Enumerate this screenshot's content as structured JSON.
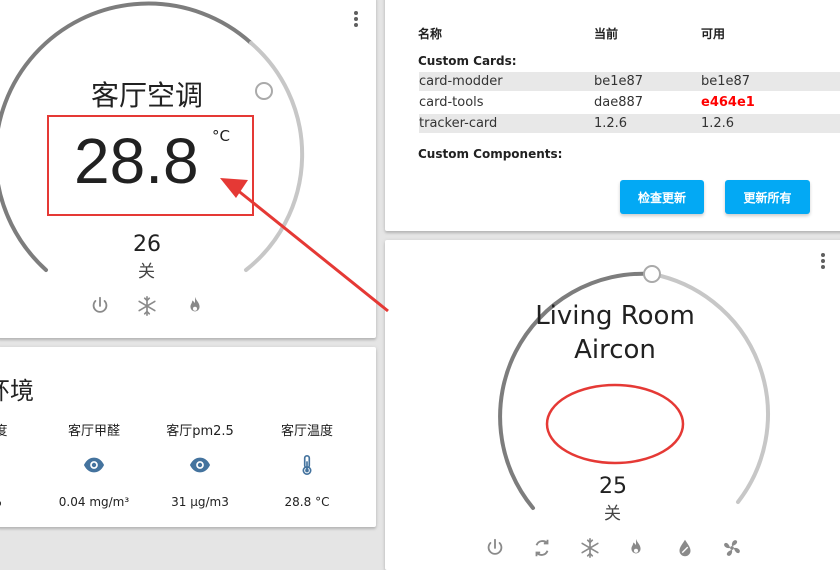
{
  "thermostat_cn": {
    "name": "客厅空调",
    "current_temp": "28.8",
    "unit": "°C",
    "target": "26",
    "mode": "关",
    "controls": [
      "power-icon",
      "snowflake-icon",
      "fire-icon"
    ]
  },
  "updates": {
    "columns": [
      "名称",
      "当前",
      "可用"
    ],
    "custom_cards_label": "Custom Cards:",
    "rows": [
      {
        "name": "card-modder",
        "current": "be1e87",
        "available": "be1e87",
        "outdated": false
      },
      {
        "name": "card-tools",
        "current": "dae887",
        "available": "e464e1",
        "outdated": true
      },
      {
        "name": "tracker-card",
        "current": "1.2.6",
        "available": "1.2.6",
        "outdated": false
      }
    ],
    "custom_components_label": "Custom Components:",
    "check_button": "检查更新",
    "update_all_button": "更新所有",
    "outdated_color": "#ff0000",
    "button_color": "#03a9f4"
  },
  "environment": {
    "title_fragment": "环境",
    "sensors": [
      {
        "name": "度",
        "value": "%",
        "icon": ""
      },
      {
        "name": "客厅甲醛",
        "value": "0.04 mg/m³",
        "icon": "eye-icon"
      },
      {
        "name": "客厅pm2.5",
        "value": "31 μg/m3",
        "icon": "eye-icon"
      },
      {
        "name": "客厅温度",
        "value": "28.8 °C",
        "icon": "thermometer-icon"
      }
    ]
  },
  "thermostat_en": {
    "name_line1": "Living Room",
    "name_line2": "Aircon",
    "target": "25",
    "mode": "关",
    "controls": [
      "power-icon",
      "cycle-icon",
      "snowflake-icon",
      "fire-icon",
      "water-drop-icon",
      "fan-icon"
    ]
  },
  "annotation": {
    "highlight_color": "#e53935"
  }
}
